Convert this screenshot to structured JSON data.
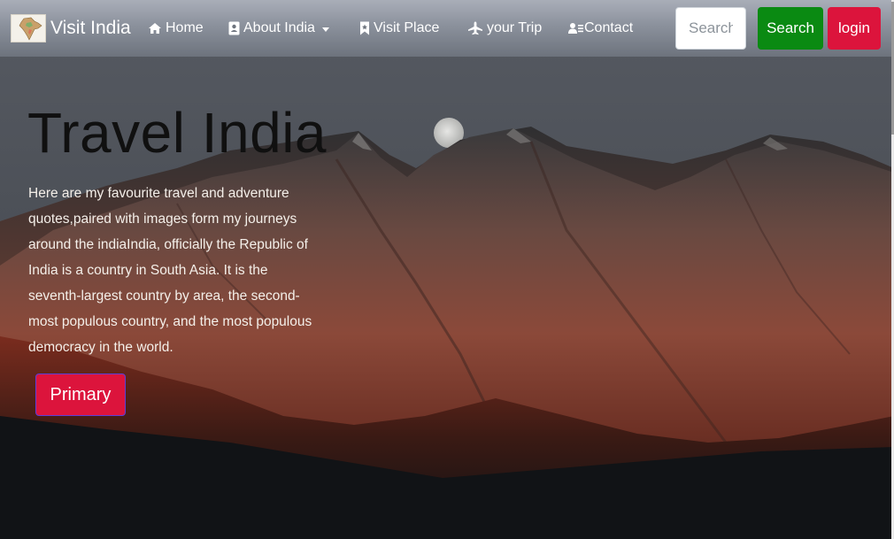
{
  "navbar": {
    "brand_name": "Visit India",
    "items": {
      "home": "Home",
      "about": "About India",
      "visit_place": "Visit Place",
      "your_trip": "your Trip",
      "contact": "Contact"
    },
    "search_placeholder": "Search",
    "search_button": "Search",
    "login_button": "login"
  },
  "hero": {
    "title": "Travel India",
    "text": "Here are my favourite travel and adventure quotes,paired with images form my journeys around the indiaIndia, officially the Republic of India is a country in South Asia. It is the seventh-largest country by area, the second-most populous country, and the most populous democracy in the world.",
    "primary_button": "Primary"
  },
  "colors": {
    "search_button": "#0a8a12",
    "login_button": "#dc143c",
    "primary_button": "#dc143c"
  },
  "icons": {
    "home": "home-icon",
    "about": "id-card-icon",
    "visit_place": "bookmark-icon",
    "your_trip": "plane-icon",
    "contact": "address-card-icon"
  }
}
